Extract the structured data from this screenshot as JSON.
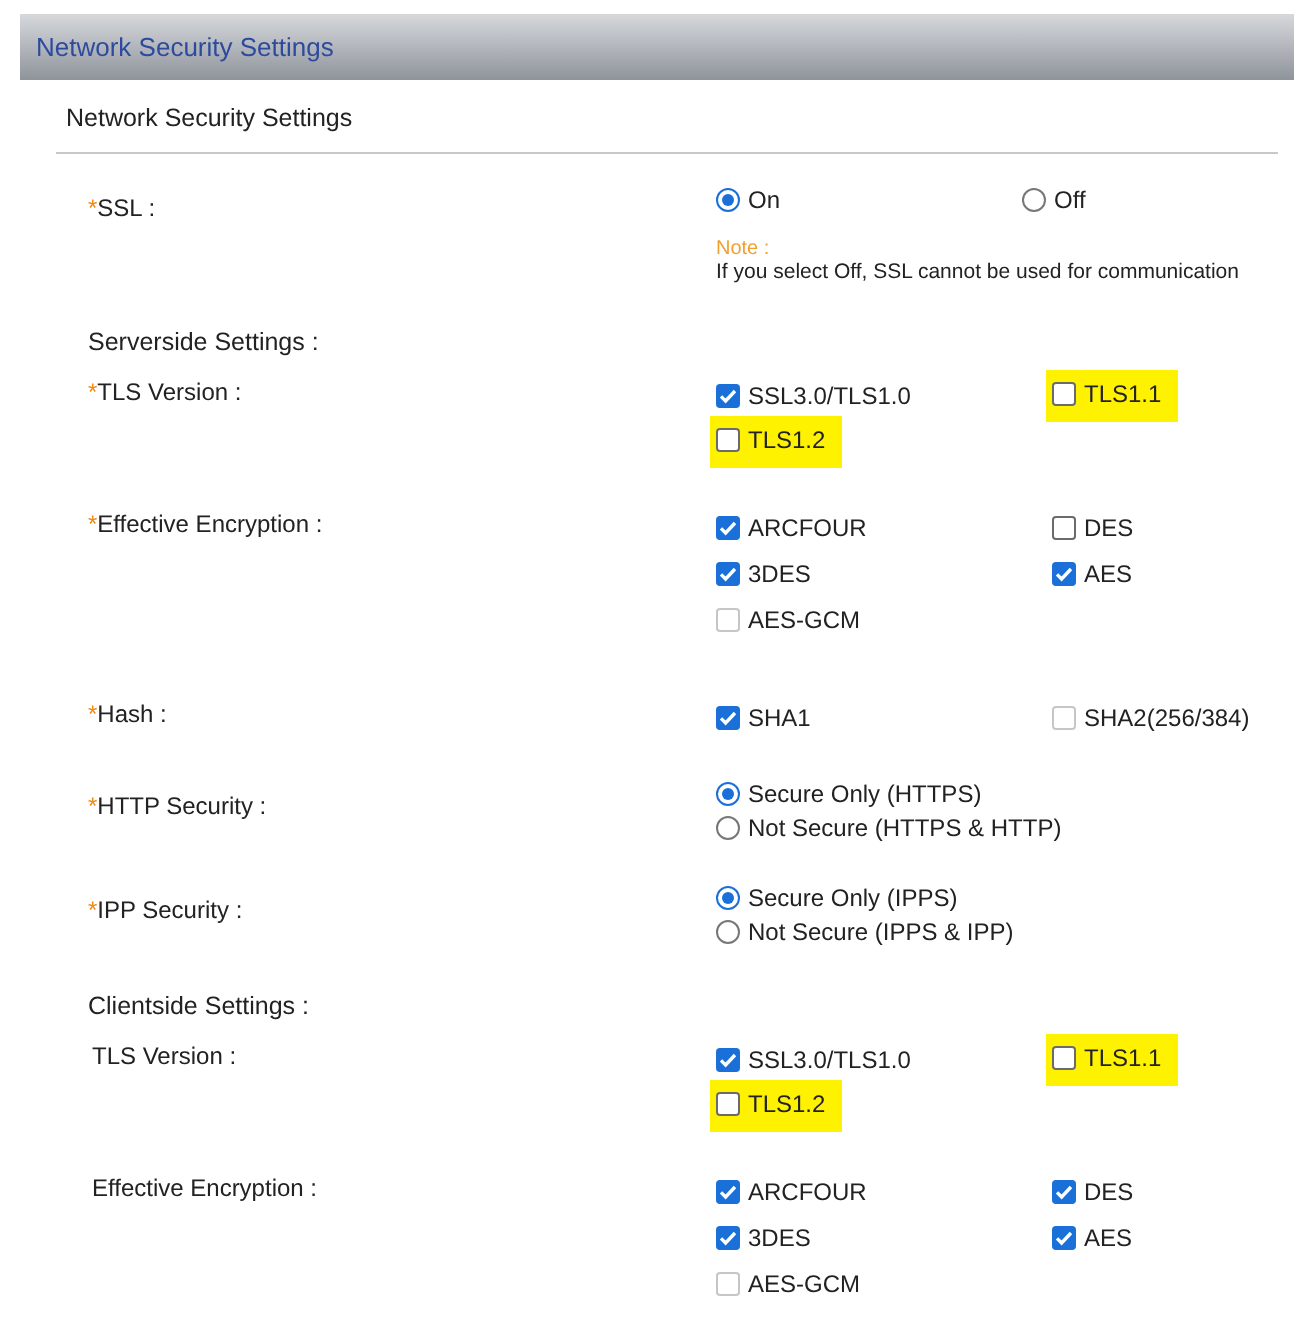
{
  "header": {
    "title": "Network Security Settings"
  },
  "panel": {
    "title": "Network Security Settings"
  },
  "rows": [
    {
      "kind": "field",
      "label": "SSL :",
      "required_mark": "*",
      "control": {
        "kind": "radio-row",
        "options": [
          {
            "label": "On",
            "selected": true
          },
          {
            "label": "Off",
            "selected": false
          }
        ]
      },
      "note": {
        "title": "Note :",
        "text": "If you select Off, SSL cannot be used for communication"
      }
    },
    {
      "kind": "heading",
      "label": "Serverside Settings :"
    },
    {
      "kind": "field",
      "label": "TLS Version :",
      "required_mark": "*",
      "control": {
        "kind": "checks",
        "options": [
          {
            "label": "SSL3.0/TLS1.0",
            "checked": true,
            "disabled": false,
            "highlighted": false
          },
          {
            "label": "TLS1.1",
            "checked": false,
            "disabled": false,
            "highlighted": true
          },
          {
            "label": "TLS1.2",
            "checked": false,
            "disabled": false,
            "highlighted": true
          }
        ]
      }
    },
    {
      "kind": "field",
      "label": "Effective Encryption :",
      "required_mark": "*",
      "control": {
        "kind": "checks",
        "options": [
          {
            "label": "ARCFOUR",
            "checked": true,
            "disabled": false,
            "highlighted": false
          },
          {
            "label": "DES",
            "checked": false,
            "disabled": false,
            "highlighted": false
          },
          {
            "label": "3DES",
            "checked": true,
            "disabled": false,
            "highlighted": false
          },
          {
            "label": "AES",
            "checked": true,
            "disabled": false,
            "highlighted": false
          },
          {
            "label": "AES-GCM",
            "checked": false,
            "disabled": true,
            "highlighted": false
          }
        ]
      }
    },
    {
      "kind": "field",
      "label": "Hash :",
      "required_mark": "*",
      "control": {
        "kind": "checks",
        "options": [
          {
            "label": "SHA1",
            "checked": true,
            "disabled": false,
            "highlighted": false
          },
          {
            "label": "SHA2(256/384)",
            "checked": false,
            "disabled": true,
            "highlighted": false
          }
        ]
      }
    },
    {
      "kind": "field",
      "label": "HTTP Security :",
      "required_mark": "*",
      "control": {
        "kind": "radio-stack",
        "options": [
          {
            "label": "Secure Only (HTTPS)",
            "selected": true
          },
          {
            "label": "Not Secure (HTTPS & HTTP)",
            "selected": false
          }
        ]
      }
    },
    {
      "kind": "field",
      "label": "IPP Security :",
      "required_mark": "*",
      "control": {
        "kind": "radio-stack",
        "options": [
          {
            "label": "Secure Only (IPPS)",
            "selected": true
          },
          {
            "label": "Not Secure (IPPS & IPP)",
            "selected": false
          }
        ]
      }
    },
    {
      "kind": "heading",
      "label": "Clientside Settings :"
    },
    {
      "kind": "field",
      "label": "TLS Version :",
      "control": {
        "kind": "checks",
        "options": [
          {
            "label": "SSL3.0/TLS1.0",
            "checked": true,
            "disabled": false,
            "highlighted": false
          },
          {
            "label": "TLS1.1",
            "checked": false,
            "disabled": false,
            "highlighted": true
          },
          {
            "label": "TLS1.2",
            "checked": false,
            "disabled": false,
            "highlighted": true
          }
        ]
      }
    },
    {
      "kind": "field",
      "label": "Effective Encryption :",
      "control": {
        "kind": "checks",
        "options": [
          {
            "label": "ARCFOUR",
            "checked": true,
            "disabled": false,
            "highlighted": false
          },
          {
            "label": "DES",
            "checked": true,
            "disabled": false,
            "highlighted": false
          },
          {
            "label": "3DES",
            "checked": true,
            "disabled": false,
            "highlighted": false
          },
          {
            "label": "AES",
            "checked": true,
            "disabled": false,
            "highlighted": false
          },
          {
            "label": "AES-GCM",
            "checked": false,
            "disabled": true,
            "highlighted": false
          }
        ]
      }
    }
  ]
}
